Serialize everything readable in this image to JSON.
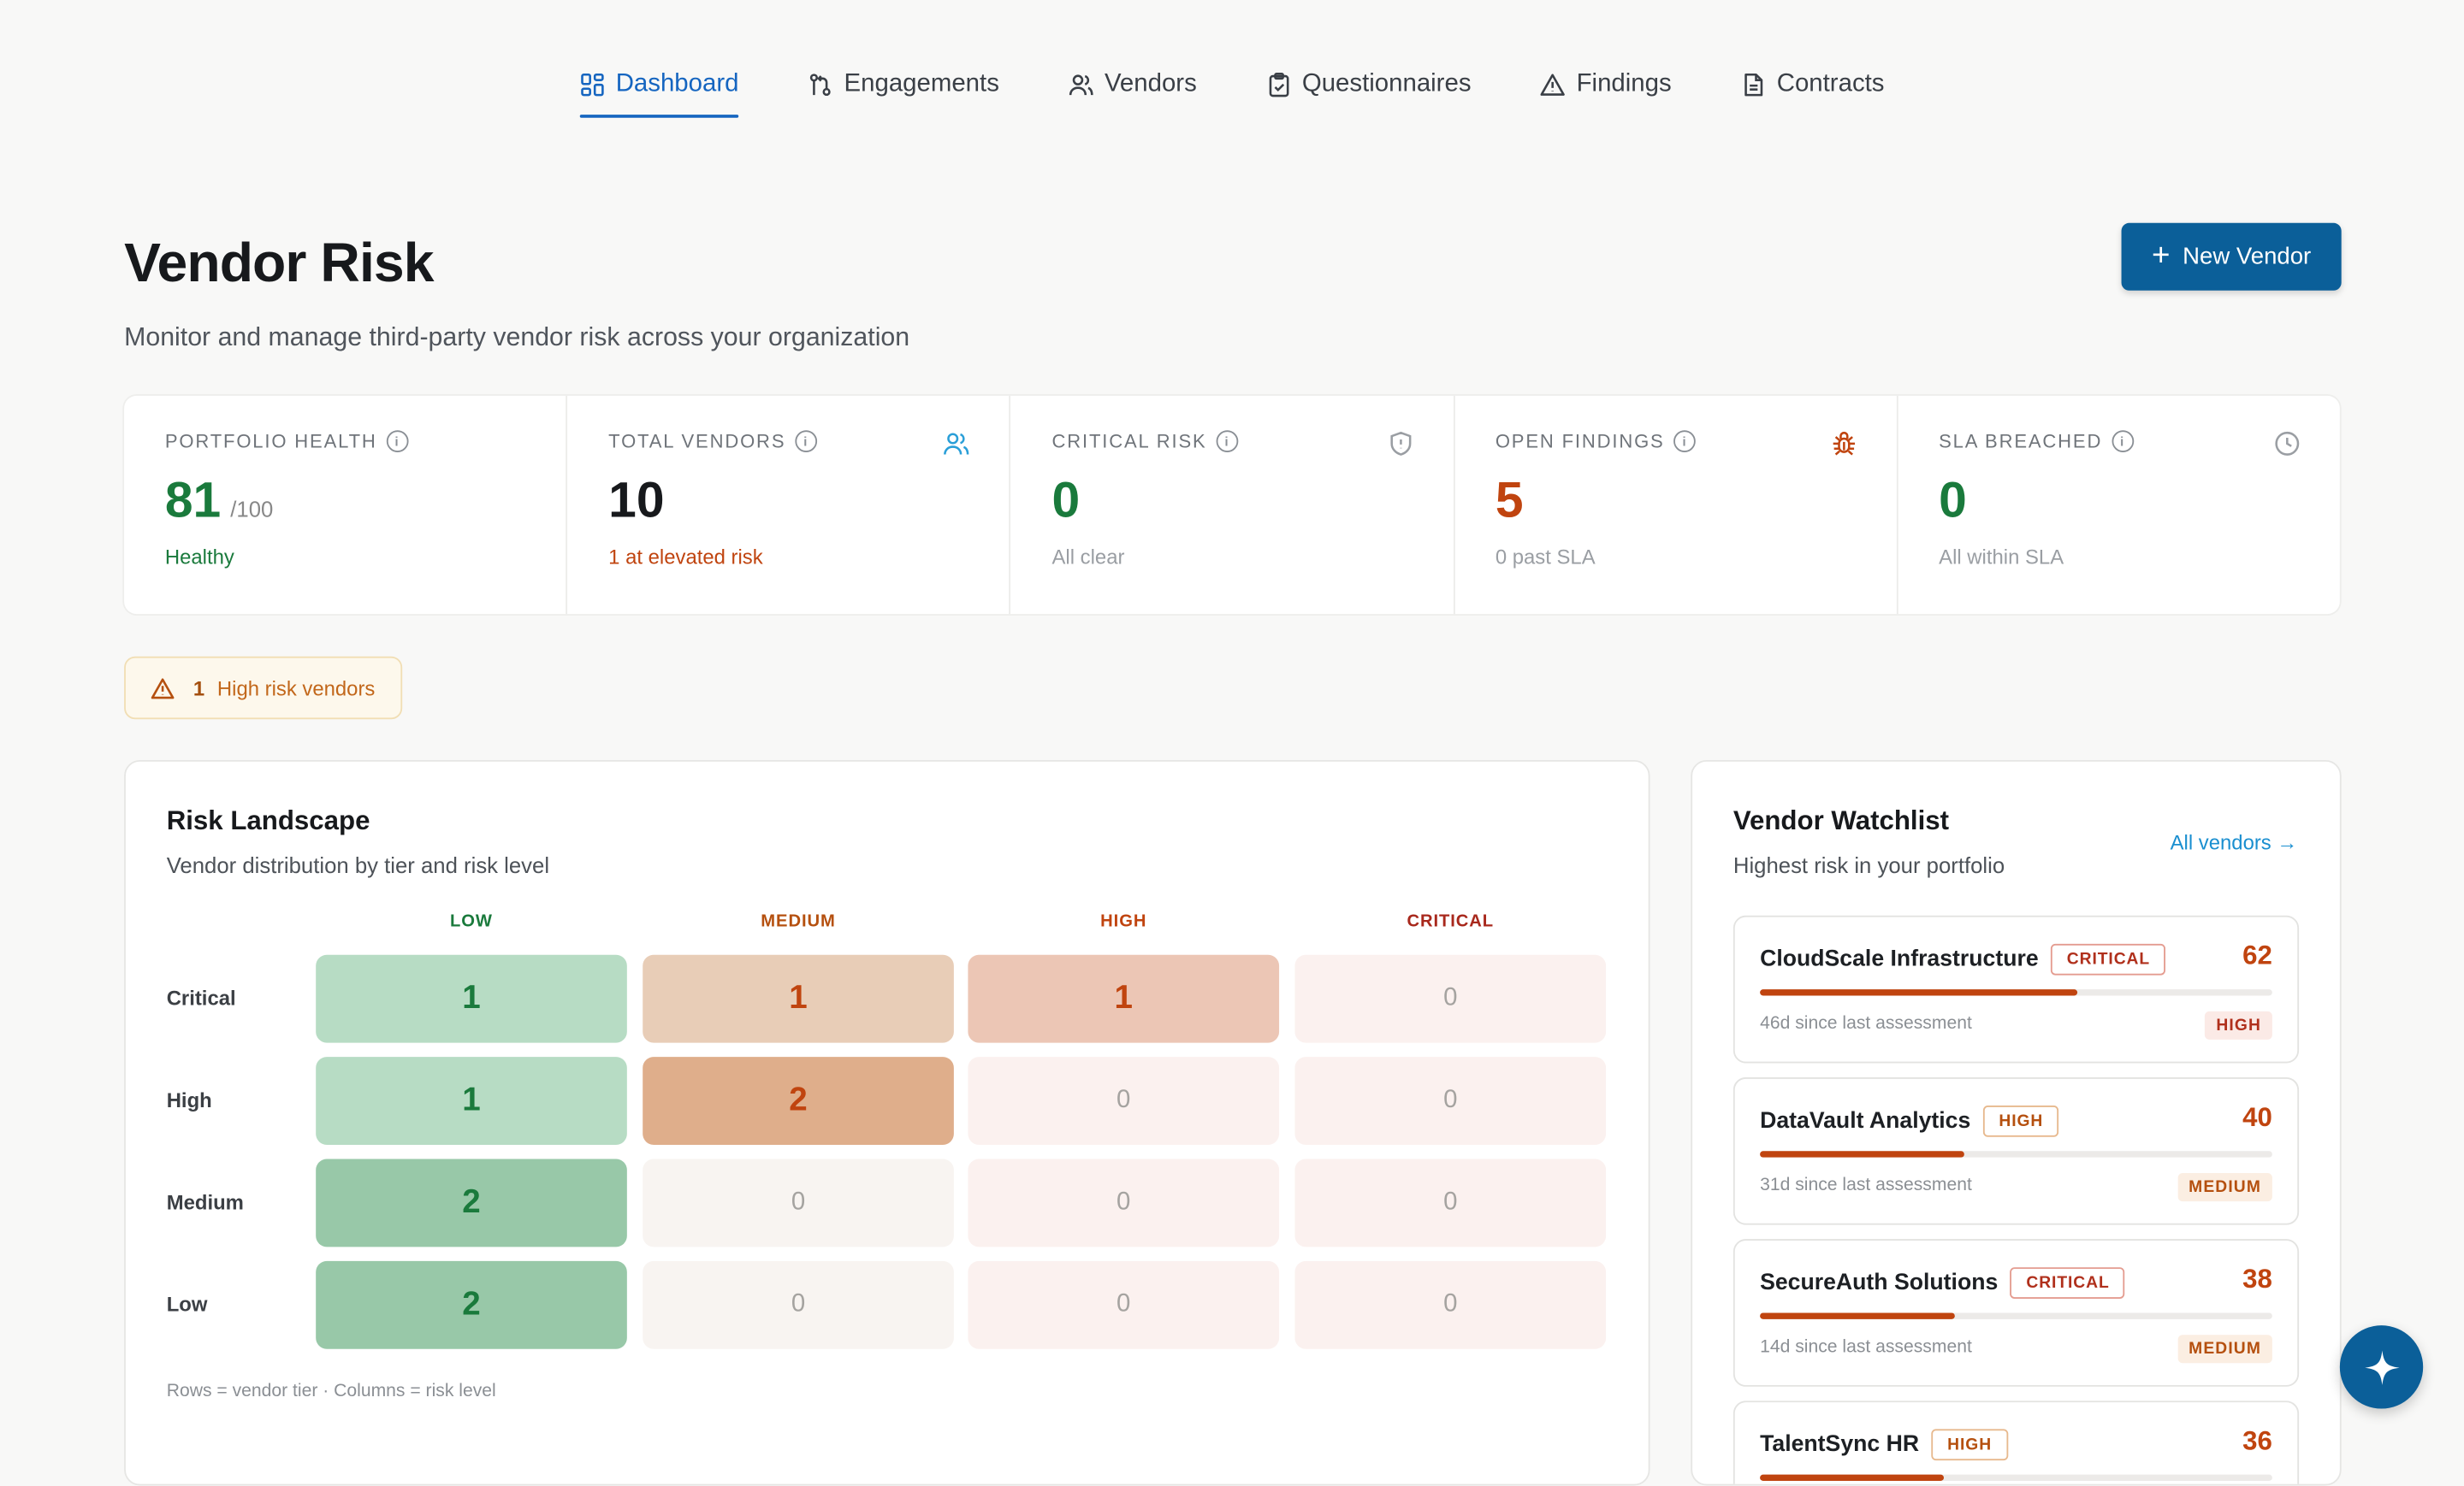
{
  "nav": [
    {
      "label": "Dashboard",
      "icon": "dashboard-icon",
      "active": true
    },
    {
      "label": "Engagements",
      "icon": "git-pull-icon"
    },
    {
      "label": "Vendors",
      "icon": "users-icon"
    },
    {
      "label": "Questionnaires",
      "icon": "clipboard-icon"
    },
    {
      "label": "Findings",
      "icon": "warning-icon"
    },
    {
      "label": "Contracts",
      "icon": "file-icon"
    }
  ],
  "header": {
    "title": "Vendor Risk",
    "subtitle": "Monitor and manage third-party vendor risk across your organization",
    "new_button": "New Vendor"
  },
  "stats": [
    {
      "label": "PORTFOLIO HEALTH",
      "value": "81",
      "suffix": "/100",
      "note": "Healthy",
      "value_color": "#1a7a3c",
      "note_color": "#1a7a3c",
      "icon": ""
    },
    {
      "label": "TOTAL VENDORS",
      "value": "10",
      "suffix": "",
      "note": "1 at elevated risk",
      "value_color": "#17191c",
      "note_color": "#c0440f",
      "icon": "users-icon",
      "icon_color": "#2a9fd8"
    },
    {
      "label": "CRITICAL RISK",
      "value": "0",
      "suffix": "",
      "note": "All clear",
      "value_color": "#1a7a3c",
      "note_color": "#9a9ea3",
      "icon": "shield-icon",
      "icon_color": "#9a9ea3"
    },
    {
      "label": "OPEN FINDINGS",
      "value": "5",
      "suffix": "",
      "note": "0 past SLA",
      "value_color": "#c0440f",
      "note_color": "#9a9ea3",
      "icon": "bug-icon",
      "icon_color": "#c0440f"
    },
    {
      "label": "SLA BREACHED",
      "value": "0",
      "suffix": "",
      "note": "All within SLA",
      "value_color": "#1a7a3c",
      "note_color": "#9a9ea3",
      "icon": "clock-icon",
      "icon_color": "#9a9ea3"
    }
  ],
  "alert": {
    "count": "1",
    "text": "High risk vendors"
  },
  "landscape": {
    "title": "Risk Landscape",
    "subtitle": "Vendor distribution by tier and risk level",
    "columns": [
      {
        "label": "LOW",
        "color": "#1a7a3c"
      },
      {
        "label": "MEDIUM",
        "color": "#b5500f"
      },
      {
        "label": "HIGH",
        "color": "#c0440f"
      },
      {
        "label": "CRITICAL",
        "color": "#a8281c"
      }
    ],
    "rows": [
      "Critical",
      "High",
      "Medium",
      "Low"
    ],
    "cells": [
      [
        "1",
        "1",
        "1",
        "0"
      ],
      [
        "1",
        "2",
        "0",
        "0"
      ],
      [
        "2",
        "0",
        "0",
        "0"
      ],
      [
        "2",
        "0",
        "0",
        "0"
      ]
    ],
    "note": "Rows = vendor tier · Columns = risk level"
  },
  "watchlist": {
    "title": "Vendor Watchlist",
    "subtitle": "Highest risk in your portfolio",
    "link": "All vendors →",
    "vendors": [
      {
        "name": "CloudScale Infrastructure",
        "badge": "CRITICAL",
        "score": "62",
        "fill": 0.62,
        "meta": "46d since last assessment",
        "tag": "HIGH"
      },
      {
        "name": "DataVault Analytics",
        "badge": "HIGH",
        "score": "40",
        "fill": 0.4,
        "meta": "31d since last assessment",
        "tag": "MEDIUM"
      },
      {
        "name": "SecureAuth Solutions",
        "badge": "CRITICAL",
        "score": "38",
        "fill": 0.38,
        "meta": "14d since last assessment",
        "tag": "MEDIUM"
      },
      {
        "name": "TalentSync HR",
        "badge": "HIGH",
        "score": "36",
        "fill": 0.36,
        "meta": "",
        "tag": ""
      }
    ]
  }
}
